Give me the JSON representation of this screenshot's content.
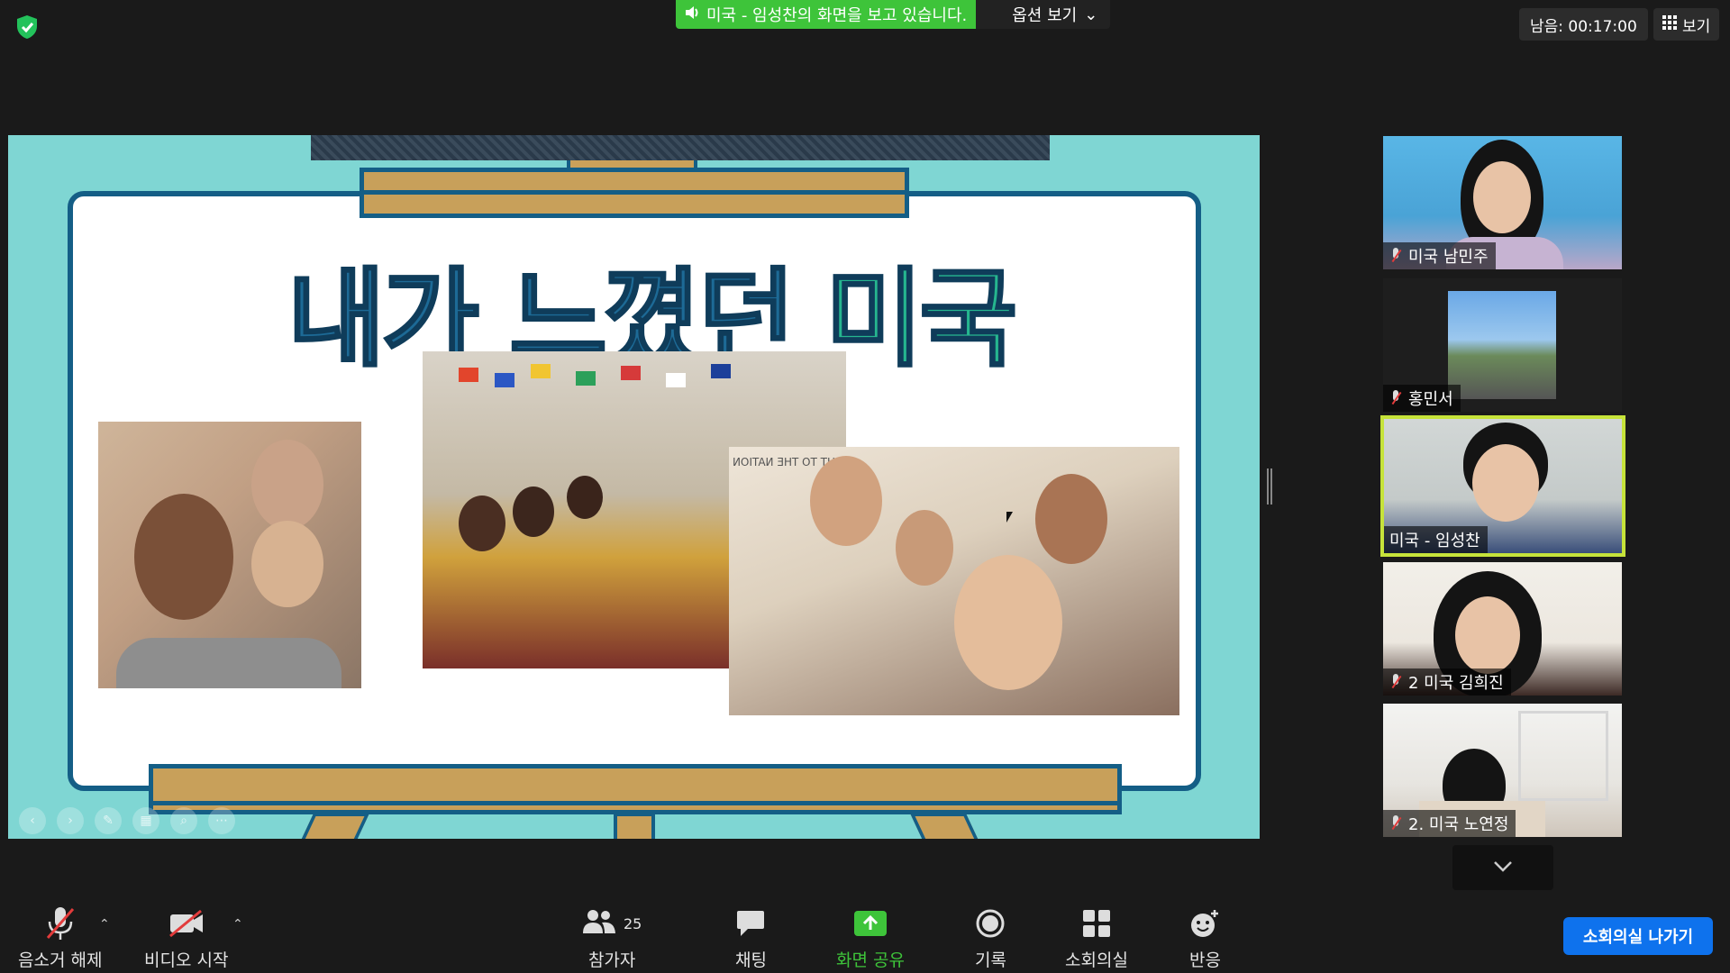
{
  "top_bar": {
    "share_banner": "미국 - 임성찬의 화면을 보고 있습니다.",
    "options_label": "옵션 보기",
    "timer": "남음: 00:17:00",
    "view_label": "보기"
  },
  "slide": {
    "title_main": "내가 느꼈던",
    "title_accent": "미국",
    "photo_3_sign": "LIGHT TO THE NATION"
  },
  "gallery": {
    "participants": [
      {
        "name": "미국 남민주",
        "muted": true
      },
      {
        "name": "홍민서",
        "muted": true
      },
      {
        "name": "미국 - 임성찬",
        "muted": false,
        "active_speaker": true
      },
      {
        "name": "2 미국 김희진",
        "muted": true
      },
      {
        "name": "2. 미국 노연정",
        "muted": true
      }
    ]
  },
  "toolbar": {
    "unmute": "음소거 해제",
    "start_video": "비디오 시작",
    "participants": "참가자",
    "participants_count": "25",
    "chat": "채팅",
    "share_screen": "화면 공유",
    "record": "기록",
    "breakout": "소회의실",
    "reactions": "반응",
    "leave_breakout": "소회의실 나가기"
  },
  "colors": {
    "share_green": "#3ec43a",
    "active_speaker_border": "#c6e33a",
    "leave_blue": "#0e72ed",
    "slide_bg": "#7fd6d3",
    "slide_title": "#1d6a96",
    "slide_title_accent": "#26b68f"
  }
}
